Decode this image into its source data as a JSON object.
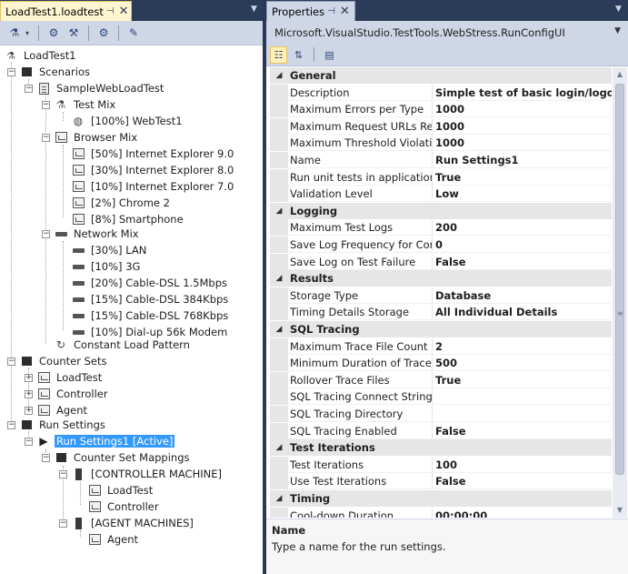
{
  "left_pane": {
    "tab_title": "LoadTest1.loadtest",
    "pin_glyph": "⊣",
    "close_glyph": "✕",
    "dropdown_glyph": "▼",
    "toolbar": {
      "icons": [
        "add-scenario-icon",
        "add-counter-set-icon",
        "run-settings-icon",
        "manage-rig-icon"
      ]
    },
    "tree": {
      "root": "LoadTest1",
      "scenarios": "Scenarios",
      "scenario_name": "SampleWebLoadTest",
      "test_mix": "Test Mix",
      "web_test": "[100%] WebTest1",
      "browser_mix": "Browser Mix",
      "browsers": [
        "[50%] Internet Explorer 9.0",
        "[30%] Internet Explorer 8.0",
        "[10%] Internet Explorer 7.0",
        "[2%] Chrome 2",
        "[8%] Smartphone"
      ],
      "network_mix": "Network Mix",
      "networks": [
        "[30%] LAN",
        "[10%] 3G",
        "[20%] Cable-DSL 1.5Mbps",
        "[15%] Cable-DSL 384Kbps",
        "[15%] Cable-DSL 768Kbps",
        "[10%] Dial-up 56k Modem"
      ],
      "load_pattern": "Constant Load Pattern",
      "counter_sets": "Counter Sets",
      "counter_set_items": [
        "LoadTest",
        "Controller",
        "Agent"
      ],
      "run_settings": "Run Settings",
      "run_settings_active": "Run Settings1 [Active]",
      "counter_set_mappings": "Counter Set Mappings",
      "controller_machine": "[CONTROLLER MACHINE]",
      "controller_children": [
        "LoadTest",
        "Controller"
      ],
      "agent_machines": "[AGENT MACHINES]",
      "agent_children": [
        "Agent"
      ]
    }
  },
  "right_pane": {
    "tab_title": "Properties",
    "object_selector": "Microsoft.VisualStudio.TestTools.WebStress.RunConfigUI",
    "categories": [
      {
        "name": "General",
        "props": [
          {
            "name": "Description",
            "value": "Simple test of basic login/logout scenarios"
          },
          {
            "name": "Maximum Errors per Type",
            "value": "1000"
          },
          {
            "name": "Maximum Request URLs Reported",
            "value": "1000"
          },
          {
            "name": "Maximum Threshold Violations",
            "value": "1000"
          },
          {
            "name": "Name",
            "value": "Run Settings1"
          },
          {
            "name": "Run unit tests in application domain",
            "value": "True"
          },
          {
            "name": "Validation Level",
            "value": "Low"
          }
        ]
      },
      {
        "name": "Logging",
        "props": [
          {
            "name": "Maximum Test Logs",
            "value": "200"
          },
          {
            "name": "Save Log Frequency for Completed Tests",
            "value": "0"
          },
          {
            "name": "Save Log on Test Failure",
            "value": "False"
          }
        ]
      },
      {
        "name": "Results",
        "props": [
          {
            "name": "Storage Type",
            "value": "Database"
          },
          {
            "name": "Timing Details Storage",
            "value": "All Individual Details"
          }
        ]
      },
      {
        "name": "SQL Tracing",
        "props": [
          {
            "name": "Maximum Trace File Count",
            "value": "2"
          },
          {
            "name": "Minimum Duration of Traced SQL Operations",
            "value": "500"
          },
          {
            "name": "Rollover Trace Files",
            "value": "True"
          },
          {
            "name": "SQL Tracing Connect String",
            "value": ""
          },
          {
            "name": "SQL Tracing Directory",
            "value": ""
          },
          {
            "name": "SQL Tracing Enabled",
            "value": "False"
          }
        ]
      },
      {
        "name": "Test Iterations",
        "props": [
          {
            "name": "Test Iterations",
            "value": "100"
          },
          {
            "name": "Use Test Iterations",
            "value": "False"
          }
        ]
      },
      {
        "name": "Timing",
        "props": [
          {
            "name": "Cool-down Duration",
            "value": "00:00:00"
          }
        ]
      }
    ],
    "description": {
      "title": "Name",
      "text": "Type a name for the run settings."
    }
  }
}
